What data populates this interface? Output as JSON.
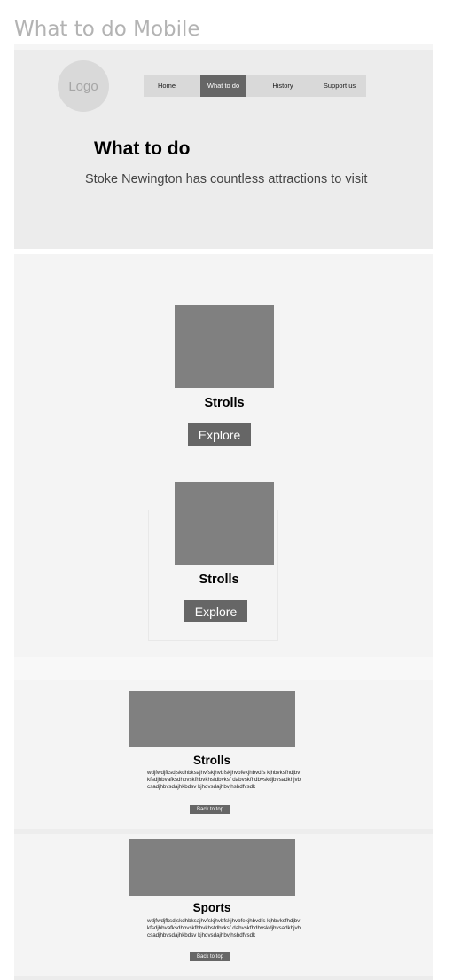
{
  "page": {
    "title": "What to do Mobile"
  },
  "header": {
    "logo_text": "Logo",
    "nav": [
      {
        "label": "Home",
        "active": false
      },
      {
        "label": "What to do",
        "active": true
      },
      {
        "label": "History",
        "active": false
      },
      {
        "label": "Support us",
        "active": false
      }
    ],
    "title": "What to do",
    "subtitle": "Stoke Newington has countless attractions to visit"
  },
  "cards": [
    {
      "title": "Strolls",
      "button": "Explore"
    },
    {
      "title": "Strolls",
      "button": "Explore"
    }
  ],
  "details": [
    {
      "title": "Strolls",
      "body": "wdjfwdjfksdjskdhbksajhvfskjhvbfskjhvbfekjhbvdfs kjhbvksfhdjbvkfsdjhbvafksdhbvskfhbvkhsfdbvksf dabvskfhdbvskdjbvsadkhjvbcsadjhbvsdajhkbdsv kjhdvsdajhbvjhsbdfvsdk",
      "button": "Back to top"
    },
    {
      "title": "Sports",
      "body": "wdjfwdjfksdjskdhbksajhvfskjhvbfskjhvbfekjhbvdfs kjhbvksfhdjbvkfsdjhbvafksdhbvskfhbvkhsfdbvksf dabvskfhdbvskdjbvsadkhjvbcsadjhbvsdajhkbdsv kjhdvsdajhbvjhsbdfvsdk",
      "button": "Back to top"
    }
  ]
}
